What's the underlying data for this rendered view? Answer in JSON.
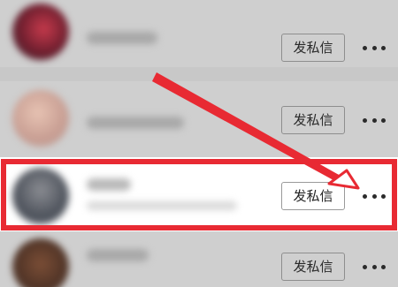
{
  "rows": [
    {
      "dm_label": "发私信"
    },
    {
      "dm_label": "发私信"
    },
    {
      "dm_label": "发私信"
    },
    {
      "dm_label": "发私信"
    }
  ],
  "colors": {
    "highlight": "#e82a33",
    "dim_overlay": "#c8c8c8",
    "active_row": "#ffffff"
  },
  "icons": {
    "more": "more-dots-icon",
    "annotation": "red-arrow-annotation"
  }
}
